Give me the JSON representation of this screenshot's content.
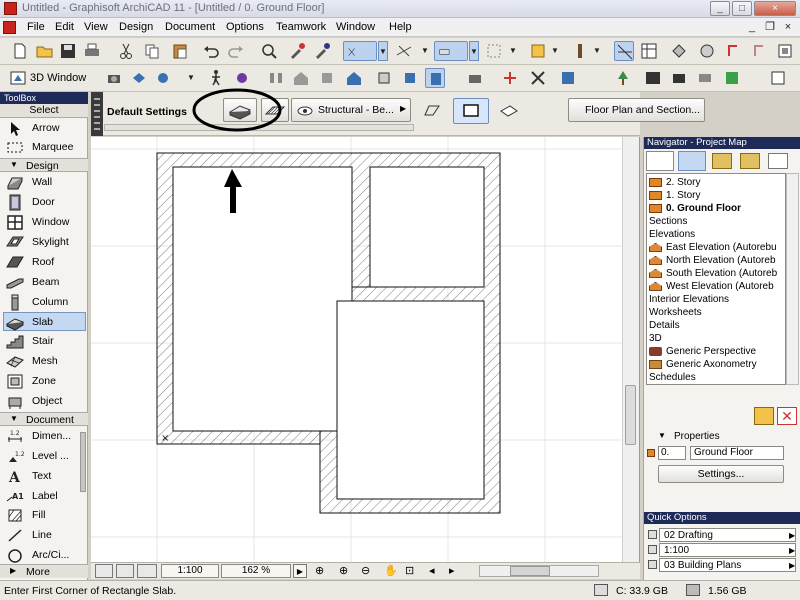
{
  "window": {
    "title": "Untitled - Graphisoft ArchiCAD 11 - [Untitled / 0. Ground Floor]",
    "controls": {
      "minimize": "_",
      "maximize": "□",
      "close": "×"
    }
  },
  "menu": {
    "items": [
      "File",
      "Edit",
      "View",
      "Design",
      "Document",
      "Options",
      "Teamwork",
      "Window",
      "Help"
    ],
    "mdi_controls": {
      "minimize": "_",
      "restore": "❐",
      "close": "×"
    }
  },
  "toolbar2": {
    "three_d_window_label": "3D Window"
  },
  "infobox": {
    "default_settings_label": "Default Settings",
    "structural_label": "Structural - Be...",
    "floor_plan_section_label": "Floor Plan and Section..."
  },
  "toolbox": {
    "title": "ToolBox",
    "select_header": "Select",
    "select_tools": [
      {
        "label": "Arrow",
        "icon": "arrow-icon"
      },
      {
        "label": "Marquee",
        "icon": "marquee-icon"
      }
    ],
    "design_header": "Design",
    "design_tools": [
      {
        "label": "Wall",
        "icon": "wall-icon"
      },
      {
        "label": "Door",
        "icon": "door-icon"
      },
      {
        "label": "Window",
        "icon": "window-icon"
      },
      {
        "label": "Skylight",
        "icon": "skylight-icon"
      },
      {
        "label": "Roof",
        "icon": "roof-icon"
      },
      {
        "label": "Beam",
        "icon": "beam-icon"
      },
      {
        "label": "Column",
        "icon": "column-icon"
      },
      {
        "label": "Slab",
        "icon": "slab-icon",
        "selected": true
      },
      {
        "label": "Stair",
        "icon": "stair-icon"
      },
      {
        "label": "Mesh",
        "icon": "mesh-icon"
      },
      {
        "label": "Zone",
        "icon": "zone-icon"
      },
      {
        "label": "Object",
        "icon": "object-icon"
      }
    ],
    "document_header": "Document",
    "document_tools": [
      {
        "label": "Dimen...",
        "icon": "dimension-icon"
      },
      {
        "label": "Level ...",
        "icon": "level-dimension-icon"
      },
      {
        "label": "Text",
        "icon": "text-icon"
      },
      {
        "label": "Label",
        "icon": "label-icon"
      },
      {
        "label": "Fill",
        "icon": "fill-icon"
      },
      {
        "label": "Line",
        "icon": "line-icon"
      },
      {
        "label": "Arc/Ci...",
        "icon": "arc-circle-icon"
      }
    ],
    "more_label": "More"
  },
  "canvas_status": {
    "scale": "1:100",
    "zoom": "162 %"
  },
  "statusbar": {
    "message": "Enter First Corner of Rectangle Slab.",
    "disk": "C: 33.9 GB",
    "memory": "1.56 GB"
  },
  "navigator": {
    "title": "Navigator - Project Map",
    "tree": [
      {
        "label": "2. Story",
        "type": "story",
        "indent": 1
      },
      {
        "label": "1. Story",
        "type": "story",
        "indent": 1
      },
      {
        "label": "0. Ground Floor",
        "type": "story",
        "indent": 1,
        "selected": true
      },
      {
        "label": "Sections",
        "type": "group",
        "indent": 0
      },
      {
        "label": "Elevations",
        "type": "group",
        "indent": 0
      },
      {
        "label": "East Elevation (Autorebu",
        "type": "elevation",
        "indent": 1
      },
      {
        "label": "North Elevation (Autoreb",
        "type": "elevation",
        "indent": 1
      },
      {
        "label": "South Elevation (Autoreb",
        "type": "elevation",
        "indent": 1
      },
      {
        "label": "West Elevation (Autoreb",
        "type": "elevation",
        "indent": 1
      },
      {
        "label": "Interior Elevations",
        "type": "group",
        "indent": 0
      },
      {
        "label": "Worksheets",
        "type": "group",
        "indent": 0
      },
      {
        "label": "Details",
        "type": "group",
        "indent": 0
      },
      {
        "label": "3D",
        "type": "group",
        "indent": 0
      },
      {
        "label": "Generic Perspective",
        "type": "perspective",
        "indent": 1
      },
      {
        "label": "Generic Axonometry",
        "type": "axonometry",
        "indent": 1
      },
      {
        "label": "Schedules",
        "type": "group",
        "indent": 0
      }
    ],
    "properties_label": "Properties",
    "properties_id": "0.",
    "properties_name": "Ground Floor",
    "settings_button": "Settings..."
  },
  "quick_options": {
    "title": "Quick Options",
    "rows": [
      "02 Drafting",
      "1:100",
      "03 Building Plans"
    ]
  },
  "colors": {
    "panel_title": "#1e2a58",
    "selection": "#c4d8f2",
    "story_icon": "#e0862b"
  }
}
